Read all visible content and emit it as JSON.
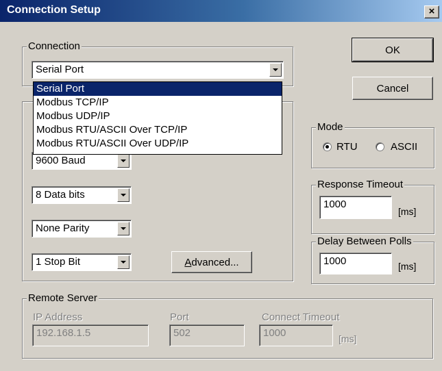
{
  "window": {
    "title": "Connection Setup",
    "close_glyph": "×"
  },
  "buttons": {
    "ok": "OK",
    "cancel": "Cancel",
    "advanced_prefix": "A",
    "advanced_rest": "dvanced..."
  },
  "connection": {
    "legend": "Connection",
    "selected": "Serial Port",
    "options": [
      "Serial Port",
      "Modbus TCP/IP",
      "Modbus UDP/IP",
      "Modbus RTU/ASCII Over TCP/IP",
      "Modbus RTU/ASCII Over UDP/IP"
    ]
  },
  "serial": {
    "baud": "9600 Baud",
    "data_bits": "8 Data bits",
    "parity": "None Parity",
    "stop_bits": "1 Stop Bit"
  },
  "mode": {
    "legend": "Mode",
    "rtu": "RTU",
    "ascii": "ASCII",
    "selected": "RTU"
  },
  "response_timeout": {
    "legend": "Response Timeout",
    "value": "1000",
    "unit": "[ms]"
  },
  "delay_between_polls": {
    "legend": "Delay Between Polls",
    "value": "1000",
    "unit": "[ms]"
  },
  "remote_server": {
    "legend": "Remote Server",
    "ip_label": "IP Address",
    "ip_value": "192.168.1.5",
    "port_label": "Port",
    "port_value": "502",
    "timeout_label": "Connect Timeout",
    "timeout_value": "1000",
    "timeout_unit": "[ms]"
  },
  "colors": {
    "face": "#d4d0c8",
    "title_start": "#0a246a",
    "title_end": "#a6caf0",
    "selection": "#0a246a"
  }
}
